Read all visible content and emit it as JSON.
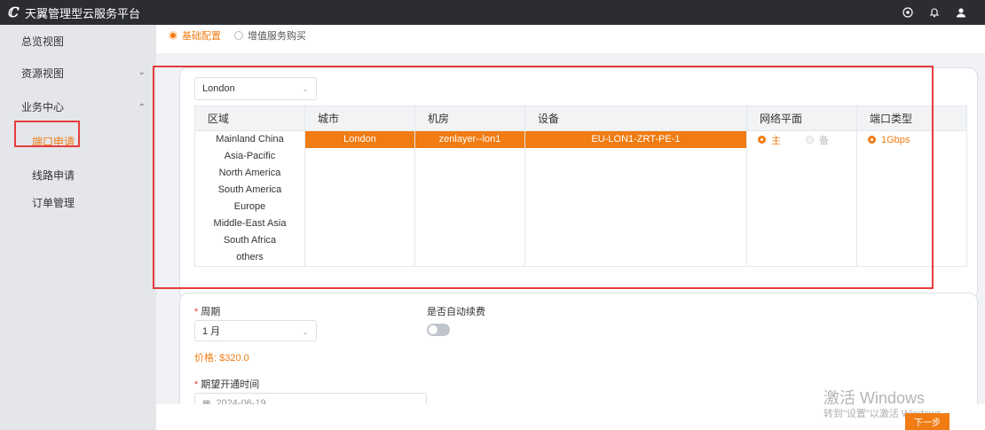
{
  "app": {
    "title": "天翼管理型云服务平台"
  },
  "topbar": {
    "icons": [
      "target-icon",
      "bell-icon",
      "user-icon"
    ]
  },
  "sidebar": {
    "items": [
      {
        "label": "总览视图"
      },
      {
        "label": "资源视图"
      },
      {
        "label": "业务中心"
      }
    ],
    "sub_items": [
      {
        "label": "端口申请"
      },
      {
        "label": "线路申请"
      },
      {
        "label": "订单管理"
      }
    ]
  },
  "steps": [
    {
      "label": "基础配置"
    },
    {
      "label": "增值服务购买"
    }
  ],
  "location_select": {
    "value": "London"
  },
  "table": {
    "headers": [
      "区域",
      "城市",
      "机房",
      "设备",
      "网络平面",
      "端口类型"
    ],
    "regions": [
      "Mainland China",
      "Asia-Pacific",
      "North America",
      "South America",
      "Europe",
      "Middle-East Asia",
      "South Africa",
      "others"
    ],
    "city": "London",
    "datacenter": "zenlayer--lon1",
    "device": "EU-LON1-ZRT-PE-1",
    "network_plane": {
      "primary": "主",
      "backup": "备"
    },
    "port_type": "1Gbps"
  },
  "form": {
    "period_label": "周期",
    "period_value": "1 月",
    "auto_renew_label": "是否自动续费",
    "price_text": "价格: $320.0",
    "open_time_label": "期望开通时间",
    "open_time_value": "2024-06-19"
  },
  "footer": {
    "next_label": "下一步"
  },
  "os_watermark": {
    "line1": "激活 Windows",
    "line2": "转到\"设置\"以激活 Windows。"
  },
  "colors": {
    "accent": "#f07c13",
    "annotation": "#e63c3c",
    "topbar": "#2b2d33"
  }
}
